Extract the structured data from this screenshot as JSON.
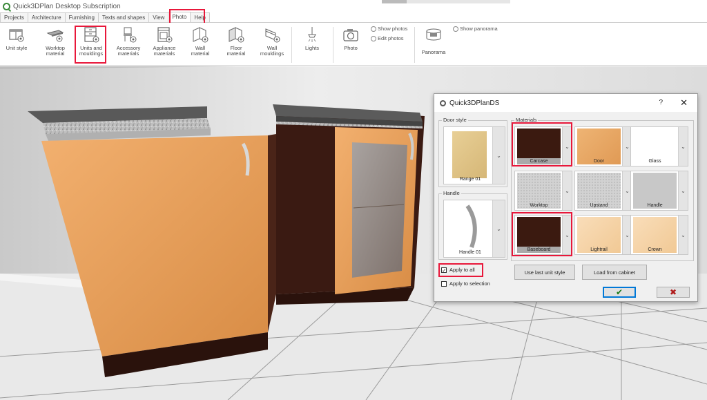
{
  "app": {
    "title": "Quick3DPlan Desktop Subscription"
  },
  "tabs": [
    {
      "label": "Projects"
    },
    {
      "label": "Architecture"
    },
    {
      "label": "Furnishing"
    },
    {
      "label": "Texts and shapes"
    },
    {
      "label": "View"
    },
    {
      "label": "Photo"
    },
    {
      "label": "Help"
    }
  ],
  "ribbon": {
    "unit_style": "Unit style",
    "worktop_material": "Worktop material",
    "units_mouldings": "Units and mouldings",
    "accessory_materials": "Accessory materials",
    "appliance_materials": "Appliance materials",
    "wall_material": "Wall material",
    "floor_material": "Floor material",
    "wall_mouldings": "Wall mouldings",
    "lights": "Lights",
    "photo": "Photo",
    "show_photos": "Show photos",
    "edit_photos": "Edit photos",
    "panorama": "Panorama",
    "show_panorama": "Show panorama"
  },
  "dialog": {
    "title": "Quick3DPlanDS",
    "help": "?",
    "close": "✕",
    "door_style_label": "Door style",
    "door_style_value": "Range 01",
    "handle_label": "Handle",
    "handle_value": "Handle 01",
    "materials_label": "Materials",
    "materials": [
      {
        "name": "Carcase",
        "color": "#3b1a10"
      },
      {
        "name": "Door",
        "color": "#e8a963"
      },
      {
        "name": "Glass",
        "color": "#ffffff"
      },
      {
        "name": "Worktop",
        "color": "#cfcfcf"
      },
      {
        "name": "Upstand",
        "color": "#cfcfcf"
      },
      {
        "name": "Handle",
        "color": "#cccccc"
      },
      {
        "name": "Baseboard",
        "color": "#3b1a10"
      },
      {
        "name": "Lightrail",
        "color": "#f6d6b0"
      },
      {
        "name": "Crown",
        "color": "#f6d6b0"
      }
    ],
    "apply_to_all": "Apply to all",
    "apply_to_selection": "Apply to selection",
    "use_last_unit_style": "Use last unit style",
    "load_from_cabinet": "Load from cabinet",
    "ok_symbol": "✔",
    "cancel_symbol": "✖"
  },
  "colors": {
    "highlight": "#e8173a",
    "ok": "#1a7a1a",
    "cancel": "#b01a1a"
  }
}
